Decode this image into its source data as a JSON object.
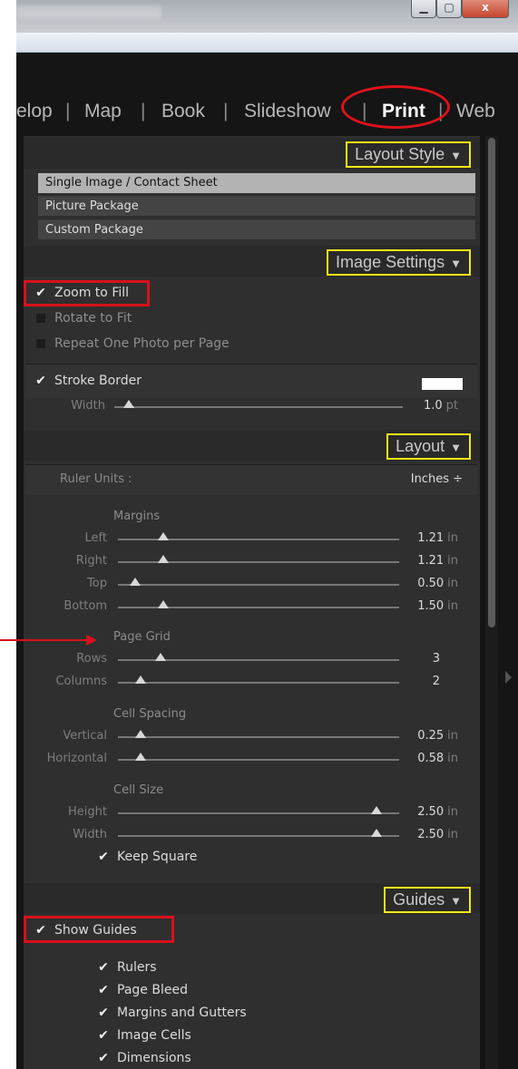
{
  "window": {
    "close_glyph": "x"
  },
  "modules": [
    "elop",
    "Map",
    "Book",
    "Slideshow",
    "Print",
    "Web"
  ],
  "layout_style": {
    "title": "Layout Style",
    "items": [
      "Single Image / Contact Sheet",
      "Picture Package",
      "Custom Package"
    ]
  },
  "image_settings": {
    "title": "Image Settings",
    "zoom_to_fill": "Zoom to Fill",
    "rotate_to_fit": "Rotate to Fit",
    "repeat_one_photo": "Repeat One Photo per Page",
    "stroke_border": "Stroke Border",
    "width_label": "Width",
    "width_value": "1.0",
    "width_unit": "pt",
    "width_fraction": 0.05,
    "stroke_color": "#ffffff"
  },
  "layout": {
    "title": "Layout",
    "ruler_units_label": "Ruler Units :",
    "ruler_units_value": "Inches ÷",
    "margins": {
      "label": "Margins",
      "rows": [
        {
          "label": "Left",
          "value": "1.21",
          "unit": "in",
          "fraction": 0.16
        },
        {
          "label": "Right",
          "value": "1.21",
          "unit": "in",
          "fraction": 0.16
        },
        {
          "label": "Top",
          "value": "0.50",
          "unit": "in",
          "fraction": 0.06
        },
        {
          "label": "Bottom",
          "value": "1.50",
          "unit": "in",
          "fraction": 0.16
        }
      ]
    },
    "page_grid": {
      "label": "Page Grid",
      "rows": [
        {
          "label": "Rows",
          "value": "3",
          "unit": "",
          "fraction": 0.15
        },
        {
          "label": "Columns",
          "value": "2",
          "unit": "",
          "fraction": 0.08
        }
      ]
    },
    "cell_spacing": {
      "label": "Cell Spacing",
      "rows": [
        {
          "label": "Vertical",
          "value": "0.25",
          "unit": "in",
          "fraction": 0.08
        },
        {
          "label": "Horizontal",
          "value": "0.58",
          "unit": "in",
          "fraction": 0.08
        }
      ]
    },
    "cell_size": {
      "label": "Cell Size",
      "rows": [
        {
          "label": "Height",
          "value": "2.50",
          "unit": "in",
          "fraction": 0.92
        },
        {
          "label": "Width",
          "value": "2.50",
          "unit": "in",
          "fraction": 0.92
        }
      ]
    },
    "keep_square": "Keep Square"
  },
  "guides": {
    "title": "Guides",
    "show_guides": "Show Guides",
    "items": [
      "Rulers",
      "Page Bleed",
      "Margins and Gutters",
      "Image Cells",
      "Dimensions"
    ]
  },
  "colors": {
    "accent_yellow": "#f2ea13",
    "annotation_red": "#d8111a"
  }
}
